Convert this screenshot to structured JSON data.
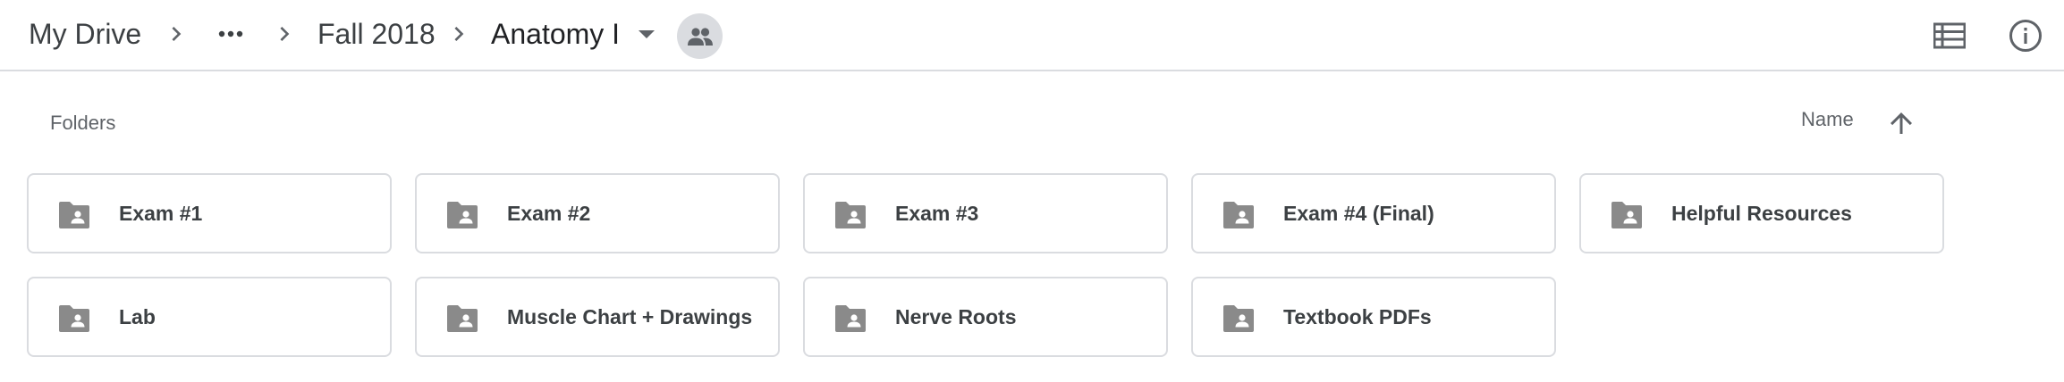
{
  "breadcrumb": {
    "items": [
      {
        "label": "My Drive"
      },
      {
        "label": "Fall 2018"
      },
      {
        "label": "Anatomy I"
      }
    ],
    "more_icon": "more-horiz-icon",
    "separator_icon": "chevron-right-icon",
    "dropdown_icon": "arrow-drop-down-icon",
    "shared_icon": "people-icon"
  },
  "toolbar": {
    "list_view_icon": "list-view-icon",
    "info_icon": "info-icon"
  },
  "section": {
    "title": "Folders",
    "sort_label": "Name",
    "sort_icon": "arrow-upward-icon"
  },
  "folders": [
    {
      "name": "Exam #1"
    },
    {
      "name": "Exam #2"
    },
    {
      "name": "Exam #3"
    },
    {
      "name": "Exam #4 (Final)"
    },
    {
      "name": "Helpful Resources"
    },
    {
      "name": "Lab"
    },
    {
      "name": "Muscle Chart + Drawings"
    },
    {
      "name": "Nerve Roots"
    },
    {
      "name": "Textbook PDFs"
    }
  ],
  "folder_icon": "shared-folder-icon",
  "colors": {
    "text_primary": "#202124",
    "text_secondary": "#5f6368",
    "icon_grey": "#5f6368",
    "folder_grey": "#8a8a8a",
    "border": "#dadce0",
    "badge_bg": "#dadce0"
  }
}
